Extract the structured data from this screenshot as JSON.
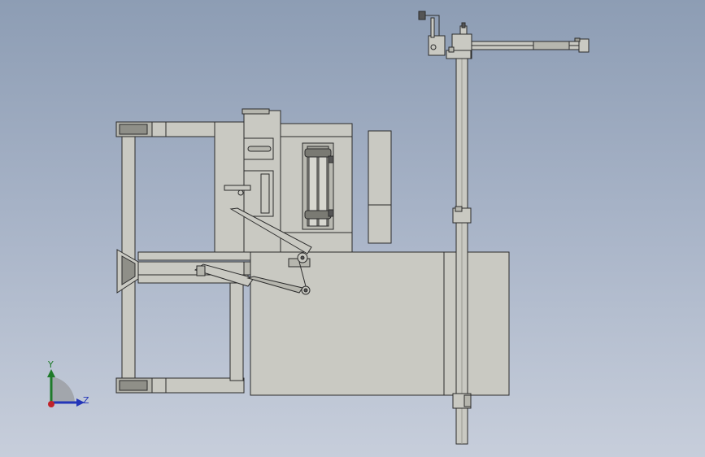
{
  "viewport": {
    "background_top": "#8d9db4",
    "background_bottom": "#c7cedb",
    "part_fill": "#c9c9c2",
    "part_stroke": "#2b2b2b",
    "part_shade": "#9a9a92"
  },
  "triad": {
    "y_label": "Y",
    "z_label": "Z",
    "y_color": "#1f7a2a",
    "z_color": "#2335b8",
    "origin_color": "#c0232a",
    "arc_color": "#8a8a8a"
  }
}
